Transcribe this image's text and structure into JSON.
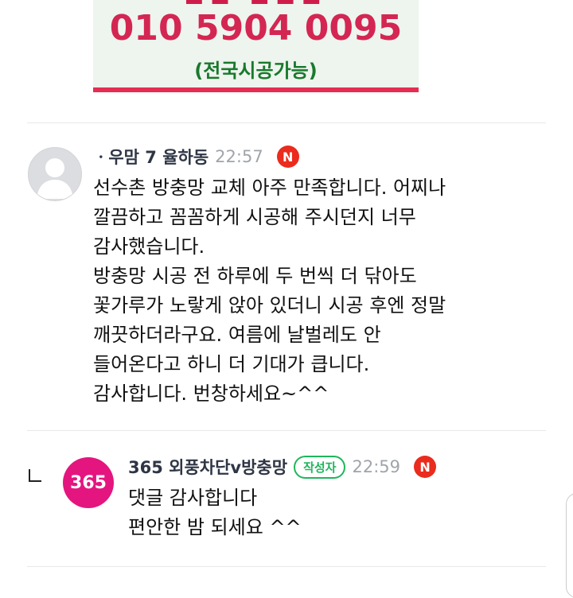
{
  "banner": {
    "phone": "010 5904 0095",
    "subtitle": "(전국시공가능)"
  },
  "comments": [
    {
      "nickname": "ㆍ우맘 7 율하동",
      "time": "22:57",
      "new_badge": "N",
      "text": "선수촌 방충망 교체 아주 만족합니다. 어찌나\n깔끔하고 꼼꼼하게 시공해 주시던지 너무\n감사했습니다.\n방충망 시공 전 하루에 두 번씩 더 닦아도\n꽃가루가 노랗게 앉아 있더니 시공 후엔 정말\n깨끗하더라구요. 여름에 날벌레도 안\n들어온다고 하니 더 기대가 큽니다.\n감사합니다. 번창하세요~^^"
    }
  ],
  "reply": {
    "avatar_text": "365",
    "nickname": "365 외풍차단v방충망",
    "author_badge": "작성자",
    "time": "22:59",
    "new_badge": "N",
    "text": "댓글 감사합니다\n편안한 밤 되세요 ^^"
  },
  "colors": {
    "banner_phone": "#d42652",
    "banner_subtitle": "#18792c",
    "author_badge": "#1fb65d",
    "new_badge": "#ea2b1d",
    "avatar_365": "#e4157f"
  },
  "icons": {
    "reply": "reply-arrow-icon",
    "default_avatar": "person-silhouette-icon"
  }
}
